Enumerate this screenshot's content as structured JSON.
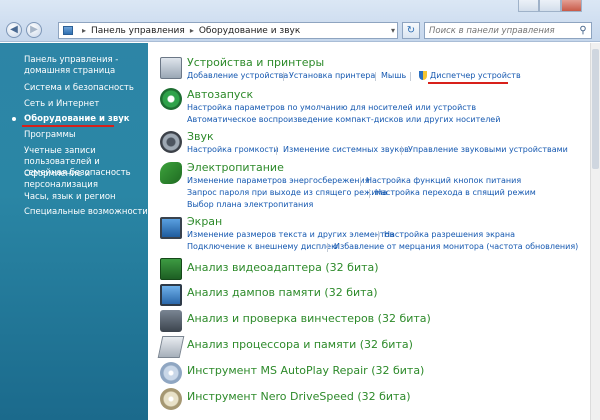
{
  "address": {
    "root": "Панель управления",
    "current": "Оборудование и звук"
  },
  "search": {
    "placeholder": "Поиск в панели управления"
  },
  "sidebar": {
    "items": [
      {
        "label": "Панель управления - домашняя страница"
      },
      {
        "label": "Система и безопасность"
      },
      {
        "label": "Сеть и Интернет"
      },
      {
        "label": "Оборудование и звук",
        "active": true
      },
      {
        "label": "Программы"
      },
      {
        "label": "Учетные записи пользователей и семейная безопасность"
      },
      {
        "label": "Оформление и персонализация"
      },
      {
        "label": "Часы, язык и регион"
      },
      {
        "label": "Специальные возможности"
      }
    ]
  },
  "categories": [
    {
      "icon": "printer-icon",
      "title": "Устройства и принтеры",
      "links": [
        "Добавление устройства",
        "Установка принтера",
        "Мышь",
        "Диспетчер устройств"
      ]
    },
    {
      "icon": "autoplay-icon",
      "title": "Автозапуск",
      "links": [
        "Настройка параметров по умолчанию для носителей или устройств",
        "Автоматическое воспроизведение компакт-дисков или других носителей"
      ]
    },
    {
      "icon": "speaker-icon",
      "title": "Звук",
      "links": [
        "Настройка громкости",
        "Изменение системных звуков",
        "Управление звуковыми устройствами"
      ]
    },
    {
      "icon": "power-icon",
      "title": "Электропитание",
      "links": [
        "Изменение параметров энергосбережения",
        "Настройка функций кнопок питания",
        "Запрос пароля при выходе из спящего режима",
        "Настройка перехода в спящий режим",
        "Выбор плана электропитания"
      ]
    },
    {
      "icon": "display-icon",
      "title": "Экран",
      "links": [
        "Изменение размеров текста и других элементов",
        "Настройка разрешения экрана",
        "Подключение к внешнему дисплею",
        "Избавление от мерцания монитора (частота обновления)"
      ]
    },
    {
      "icon": "video-card-icon",
      "title": "Анализ видеоадаптера (32 бита)"
    },
    {
      "icon": "monitor-icon",
      "title": "Анализ дампов памяти (32 бита)"
    },
    {
      "icon": "hard-drive-icon",
      "title": "Анализ и проверка винчестеров (32 бита)"
    },
    {
      "icon": "cpu-icon",
      "title": "Анализ процессора и памяти (32 бита)"
    },
    {
      "icon": "cd-icon",
      "title": "Инструмент MS AutoPlay Repair (32 бита)"
    },
    {
      "icon": "disc-icon",
      "title": "Инструмент Nero DriveSpeed (32 бита)"
    }
  ],
  "colors": {
    "sidebar": "#2a86a5",
    "category_title": "#2d8a2a",
    "link": "#1558b0",
    "highlight": "#d8201a"
  }
}
